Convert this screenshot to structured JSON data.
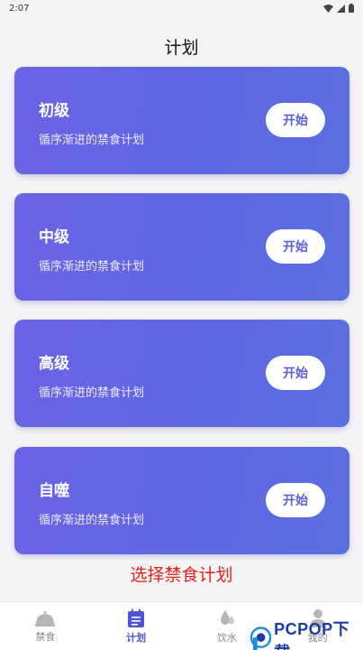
{
  "status_bar": {
    "time": "2:07"
  },
  "header": {
    "title": "计划"
  },
  "plans": [
    {
      "name": "初级",
      "description": "循序渐进的禁食计划",
      "button": "开始"
    },
    {
      "name": "中级",
      "description": "循序渐进的禁食计划",
      "button": "开始"
    },
    {
      "name": "高级",
      "description": "循序渐进的禁食计划",
      "button": "开始"
    },
    {
      "name": "自噬",
      "description": "循序渐进的禁食计划",
      "button": "开始"
    }
  ],
  "hint": "选择禁食计划",
  "tabs": [
    {
      "label": "禁食",
      "icon": "fasting-icon",
      "active": false
    },
    {
      "label": "计划",
      "icon": "plan-icon",
      "active": true
    },
    {
      "label": "饮水",
      "icon": "water-drop-icon",
      "active": false
    },
    {
      "label": "我的",
      "icon": "profile-icon",
      "active": false
    }
  ],
  "watermark": {
    "text": "PCPOP下载"
  },
  "colors": {
    "card_gradient_start": "#6a64e6",
    "card_gradient_end": "#5b6fe0",
    "hint": "#e2231a",
    "tab_active": "#4d55d6",
    "tab_inactive": "#888888"
  }
}
